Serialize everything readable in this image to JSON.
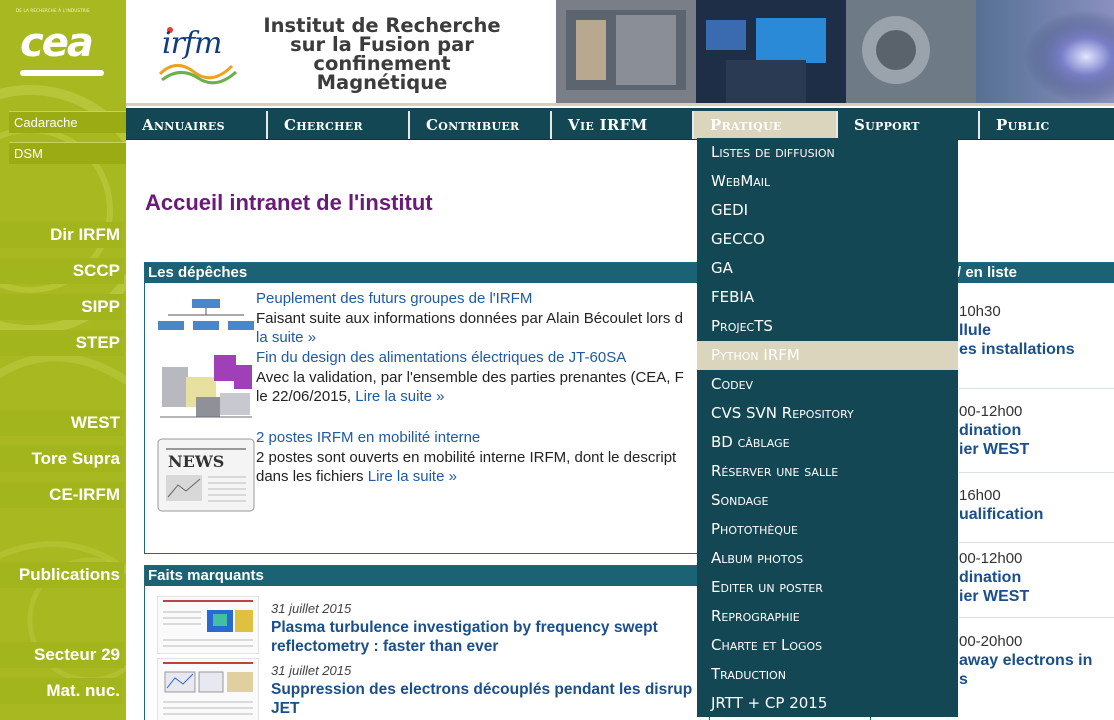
{
  "sidebar": {
    "logo": {
      "tagline": "DE LA RECHERCHE À L'INDUSTRIE",
      "word": "cea"
    },
    "small_links": [
      "Cadarache",
      "DSM"
    ],
    "links": [
      "Dir IRFM",
      "SCCP",
      "SIPP",
      "STEP",
      "WEST",
      "Tore Supra",
      "CE-IRFM",
      "Publications",
      "Secteur 29",
      "Mat. nuc."
    ]
  },
  "header": {
    "logo_word": "irfm",
    "title": "Institut de Recherche sur la Fusion par confinement Magnétique"
  },
  "nav": {
    "items": [
      "Annuaires",
      "Chercher",
      "Contribuer",
      "Vie IRFM",
      "Pratique",
      "Support",
      "Public"
    ],
    "active": "Pratique"
  },
  "main": {
    "page_title": "Accueil intranet de l'institut",
    "depeches": {
      "heading": "Les dépêches",
      "items": [
        {
          "title": "Peuplement des futurs groupes de l'IRFM",
          "text": "Faisant suite aux informations données par Alain Bécoulet lors d",
          "more": "la suite »"
        },
        {
          "title": "Fin du design des alimentations électriques de JT-60SA",
          "text": "Avec la validation, par l'ensemble des parties prenantes (CEA, F",
          "text2": "le 22/06/2015,",
          "more": "Lire la suite »"
        },
        {
          "title": "2 postes IRFM en mobilité interne",
          "text": "2 postes sont ouverts en mobilité interne IRFM, dont le descript",
          "text2": "dans les fichiers",
          "more": "Lire la suite »"
        }
      ],
      "news_label": "NEWS"
    },
    "faits": {
      "heading": "Faits marquants",
      "items": [
        {
          "date": "31 juillet 2015",
          "title": "Plasma turbulence investigation by frequency swept reflectometry : faster than ever"
        },
        {
          "date": "31 juillet 2015",
          "title": "Suppression des electrons découplés pendant les disrup JET"
        }
      ]
    },
    "agenda": {
      "heading": "/ en liste",
      "rows": [
        {
          "time": "10h30",
          "line1": "llule",
          "line2": "es installations"
        },
        {
          "time": "00-12h00",
          "line1": "dination",
          "line2": "ier WEST"
        },
        {
          "time": "16h00",
          "line1": "ualification",
          "line2": ""
        },
        {
          "time": "00-12h00",
          "line1": "dination",
          "line2": "ier WEST"
        },
        {
          "time": "00-20h00",
          "line1": "away electrons in",
          "line2": "s"
        }
      ]
    }
  },
  "dropdown": {
    "items": [
      "Listes de diffusion",
      "WebMail",
      "GEDI",
      "GECCO",
      "GA",
      "FEBIA",
      "ProjecTS",
      "Python IRFM",
      "Codev",
      "CVS SVN Repository",
      "BD câblage",
      "Réserver une salle",
      "Sondage",
      "Photothèque",
      "Album photos",
      "Editer un poster",
      "Reprographie",
      "Charte et Logos",
      "Traduction",
      "JRTT + CP 2015"
    ],
    "hovered": "Python IRFM"
  },
  "colors": {
    "nav_bg": "#134753",
    "sidebar_green": "#a8b820",
    "title_purple": "#6a1a78",
    "link_blue": "#1f5aa6",
    "hover_beige": "#dcd5bd"
  }
}
